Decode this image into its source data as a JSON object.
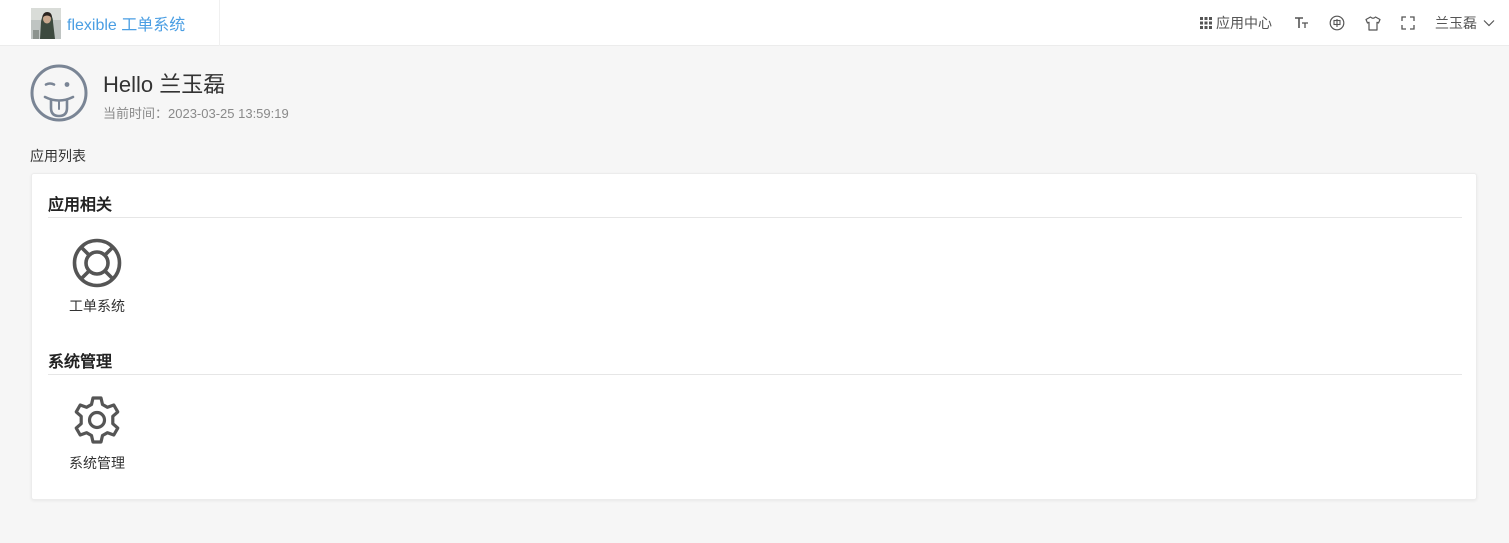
{
  "header": {
    "brand_title": "flexible 工单系统",
    "app_center_label": "应用中心",
    "user_name": "兰玉磊"
  },
  "greeting": {
    "title": "Hello 兰玉磊",
    "time_text": "当前时间：2023-03-25 13:59:19"
  },
  "app_list": {
    "label": "应用列表",
    "groups": [
      {
        "title": "应用相关",
        "apps": [
          {
            "label": "工单系统",
            "icon": "lifebuoy-icon"
          }
        ]
      },
      {
        "title": "系统管理",
        "apps": [
          {
            "label": "系统管理",
            "icon": "gear-icon"
          }
        ]
      }
    ]
  },
  "colors": {
    "brand": "#4a9ee3",
    "avatar_stroke": "#7a8595",
    "app_icon": "#555555"
  },
  "icons": {
    "toolbar": [
      "grid-icon",
      "font-size-icon",
      "language-icon",
      "skin-icon",
      "fullscreen-icon",
      "chevron-down-icon"
    ]
  }
}
